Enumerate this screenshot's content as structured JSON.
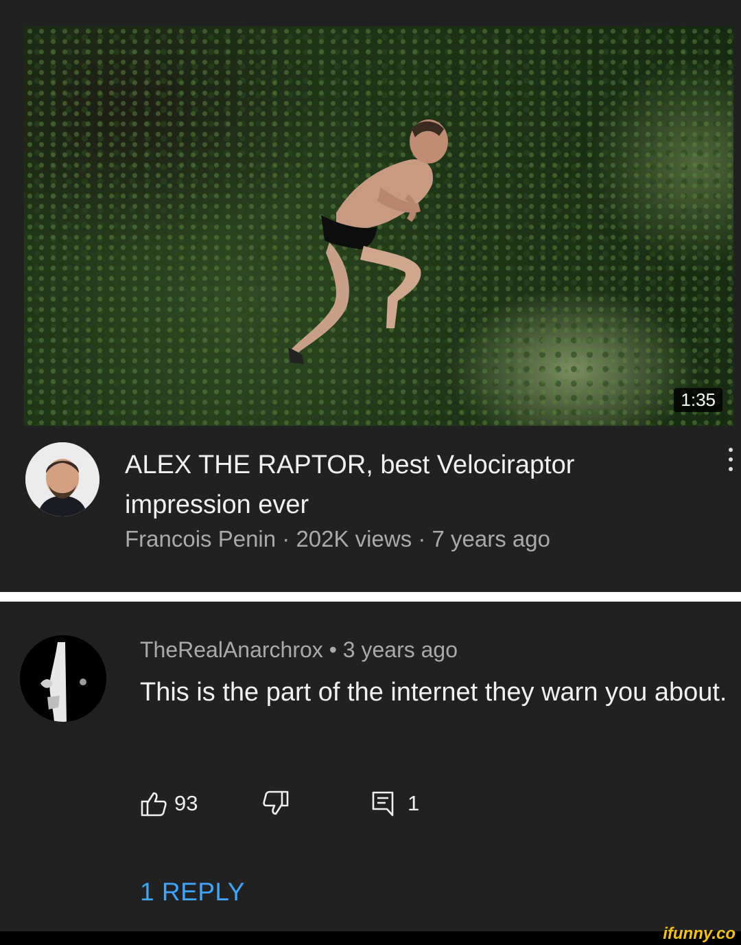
{
  "video": {
    "duration": "1:35",
    "title": "ALEX THE RAPTOR, best Velociraptor impression ever",
    "channel": "Francois Penin",
    "views": "202K views",
    "age": "7 years ago",
    "separator": " · "
  },
  "comment": {
    "author": "TheRealAnarchrox",
    "dot": " • ",
    "age": "3 years ago",
    "text": "This is the part of the internet they warn you about.",
    "likes": "93",
    "reply_count": "1",
    "replies_link": "1 REPLY"
  },
  "icons": {
    "like": "thumbs-up-icon",
    "dislike": "thumbs-down-icon",
    "reply": "comment-icon",
    "more": "kebab-menu-icon"
  },
  "watermark": "ifunny.co",
  "colors": {
    "background": "#212121",
    "link": "#3ea6ff",
    "secondary_text": "#aaaaaa",
    "watermark": "#f5c400"
  }
}
